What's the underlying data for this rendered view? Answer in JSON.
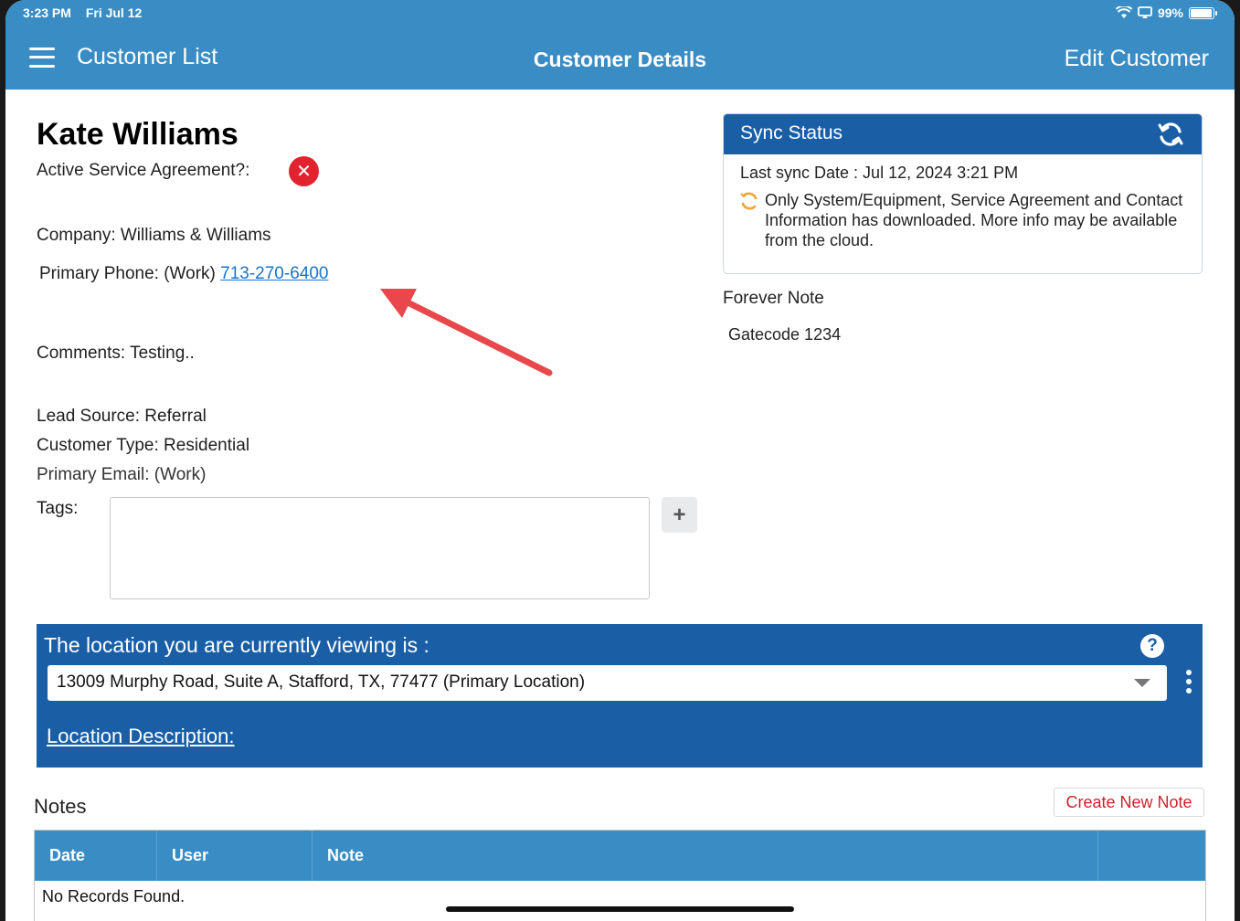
{
  "status_bar": {
    "time": "3:23 PM",
    "date": "Fri Jul 12",
    "battery": "99%"
  },
  "nav": {
    "back_label": "Customer List",
    "title": "Customer Details",
    "edit_label": "Edit Customer"
  },
  "customer": {
    "name": "Kate Williams",
    "agreement_label": "Active Service Agreement?:",
    "company": "Company: Williams & Williams",
    "phone_label": "Primary Phone: (Work)",
    "phone_number": "713-270-6400",
    "comments": "Comments: Testing..",
    "lead_source": "Lead Source: Referral",
    "customer_type": "Customer Type: Residential",
    "email": "Primary Email: (Work)",
    "tags_label": "Tags:"
  },
  "sync": {
    "title": "Sync Status",
    "last_sync": "Last sync Date : Jul 12, 2024 3:21 PM",
    "message": "Only System/Equipment, Service Agreement and Contact Information has downloaded. More info may be available from the cloud."
  },
  "forever_note": {
    "title": "Forever Note",
    "value": "Gatecode 1234"
  },
  "location": {
    "title": "The location you are currently viewing is :",
    "selected": "13009 Murphy Road, Suite A, Stafford, TX, 77477 (Primary Location)",
    "description_link": "Location Description:"
  },
  "notes": {
    "title": "Notes",
    "create_label": "Create New Note",
    "columns": [
      "Date",
      "User",
      "Note"
    ],
    "empty": "No Records Found."
  },
  "colors": {
    "header_blue": "#3a8dc4",
    "panel_blue": "#1a5fa6",
    "error_red": "#e0232e",
    "annotation_arrow": "#e8484b"
  }
}
